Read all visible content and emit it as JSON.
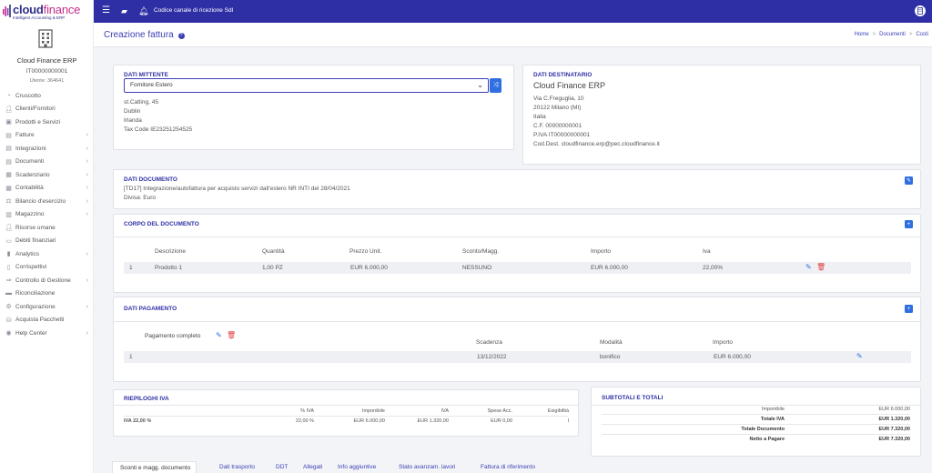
{
  "app": {
    "logo_main": "cloud",
    "logo_accent": "finance",
    "logo_sub": "Intelligent Accounting & ERP"
  },
  "company": {
    "name": "Cloud Finance ERP",
    "id": "IT00000000001",
    "user": "Utente: 364641"
  },
  "sidebar": {
    "items": [
      {
        "label": "Cruscotto",
        "icon": "dashboard-icon",
        "has_children": false
      },
      {
        "label": "Clienti/Fornitori",
        "icon": "user-icon",
        "has_children": false
      },
      {
        "label": "Prodotti e Servizi",
        "icon": "box-icon",
        "has_children": false
      },
      {
        "label": "Fatture",
        "icon": "file-icon",
        "has_children": true
      },
      {
        "label": "Integrazioni",
        "icon": "file-icon",
        "has_children": true
      },
      {
        "label": "Documenti",
        "icon": "file-icon",
        "has_children": true
      },
      {
        "label": "Scadenziario",
        "icon": "calendar-icon",
        "has_children": true
      },
      {
        "label": "Contabilità",
        "icon": "calculator-icon",
        "has_children": true
      },
      {
        "label": "Bilancio d'esercizio",
        "icon": "scale-icon",
        "has_children": true
      },
      {
        "label": "Magazzino",
        "icon": "warehouse-icon",
        "has_children": true
      },
      {
        "label": "Risorse umane",
        "icon": "people-icon",
        "has_children": false
      },
      {
        "label": "Debiti finanziari",
        "icon": "money-icon",
        "has_children": false
      },
      {
        "label": "Analytics",
        "icon": "chart-icon",
        "has_children": true
      },
      {
        "label": "Corrispettivi",
        "icon": "receipt-icon",
        "has_children": false
      },
      {
        "label": "Controllo di Gestione",
        "icon": "arrows-icon",
        "has_children": true
      },
      {
        "label": "Riconciliazione",
        "icon": "bank-icon",
        "has_children": false
      },
      {
        "label": "Configurazione",
        "icon": "gear-icon",
        "has_children": true
      },
      {
        "label": "Acquista Pacchetti",
        "icon": "cart-icon",
        "has_children": false
      },
      {
        "label": "Help Center",
        "icon": "help-icon",
        "has_children": true
      }
    ]
  },
  "topbar": {
    "text": "Codice canale di ricezione SdI"
  },
  "header": {
    "title": "Creazione fattura",
    "breadcrumb": [
      "Home",
      "Documenti",
      "Costi"
    ]
  },
  "mittente": {
    "title": "DATI MITTENTE",
    "selected": "Fornitore Estero",
    "lines": [
      "st.Catling, 45",
      "Dublin",
      "Irlanda",
      "Tax Code IE23251254525"
    ]
  },
  "destinatario": {
    "title": "DATI DESTINATARIO",
    "name": "Cloud Finance ERP",
    "lines": [
      "Via C.Freguglia, 10",
      "20122 Milano (MI)",
      "Italia",
      "C.F. 00000000001",
      "P.IVA IT00000000001",
      "Cod.Dest. cloudfinance.erp@pec.cloudfinance.it"
    ]
  },
  "documento": {
    "title": "DATI DOCUMENTO",
    "line1": "[TD17] Integrazione/autofattura per acquisto servizi dall'estero NR INTI del 28/04/2021",
    "line2": "Divisa: Euro"
  },
  "corpo": {
    "title": "CORPO DEL DOCUMENTO",
    "headers": [
      "Descrizione",
      "Quantità",
      "Prezzo Unit.",
      "Sconto/Magg.",
      "Importo",
      "Iva"
    ],
    "rows": [
      [
        "1",
        "Prodotto 1",
        "1,00 PZ",
        "EUR 6.000,00",
        "NESSUNO",
        "EUR 6.000,00",
        "22,00%"
      ]
    ]
  },
  "pagamento": {
    "title": "DATI PAGAMENTO",
    "subtitle": "Pagamento completo",
    "headers": [
      "Scadenza",
      "Modalità",
      "Importo"
    ],
    "rows": [
      [
        "1",
        "13/12/2022",
        "bonifico",
        "EUR 6.000,00"
      ]
    ]
  },
  "riepiloghi": {
    "title": "RIEPILOGHI IVA",
    "headers": [
      "% IVA",
      "Imponibile",
      "IVA",
      "Spese Acc.",
      "Esigibilità"
    ],
    "rows": [
      [
        "IVA 22,00 %",
        "22,00 %",
        "EUR 6.000,00",
        "EUR 1.320,00",
        "EUR 0,00",
        "I"
      ]
    ]
  },
  "subtotali": {
    "title": "SUBTOTALI E TOTALI",
    "rows": [
      [
        "Imponibile",
        "EUR 6.000,00"
      ],
      [
        "Totale IVA",
        "EUR 1.320,00"
      ],
      [
        "Totale Documento",
        "EUR 7.320,00"
      ],
      [
        "Netto a Pagare",
        "EUR 7.320,00"
      ]
    ]
  },
  "tabs": [
    "Sconti e magg. documento",
    "Dati trasporto",
    "DDT",
    "Allegati",
    "Info aggiuntive",
    "Stato avanzam. lavori",
    "Fattura di riferimento"
  ],
  "colors": {
    "primary": "#2f2fa5",
    "accent": "#2f6fe0",
    "danger": "#e23b3b",
    "brand_pink": "#c62d8c"
  }
}
